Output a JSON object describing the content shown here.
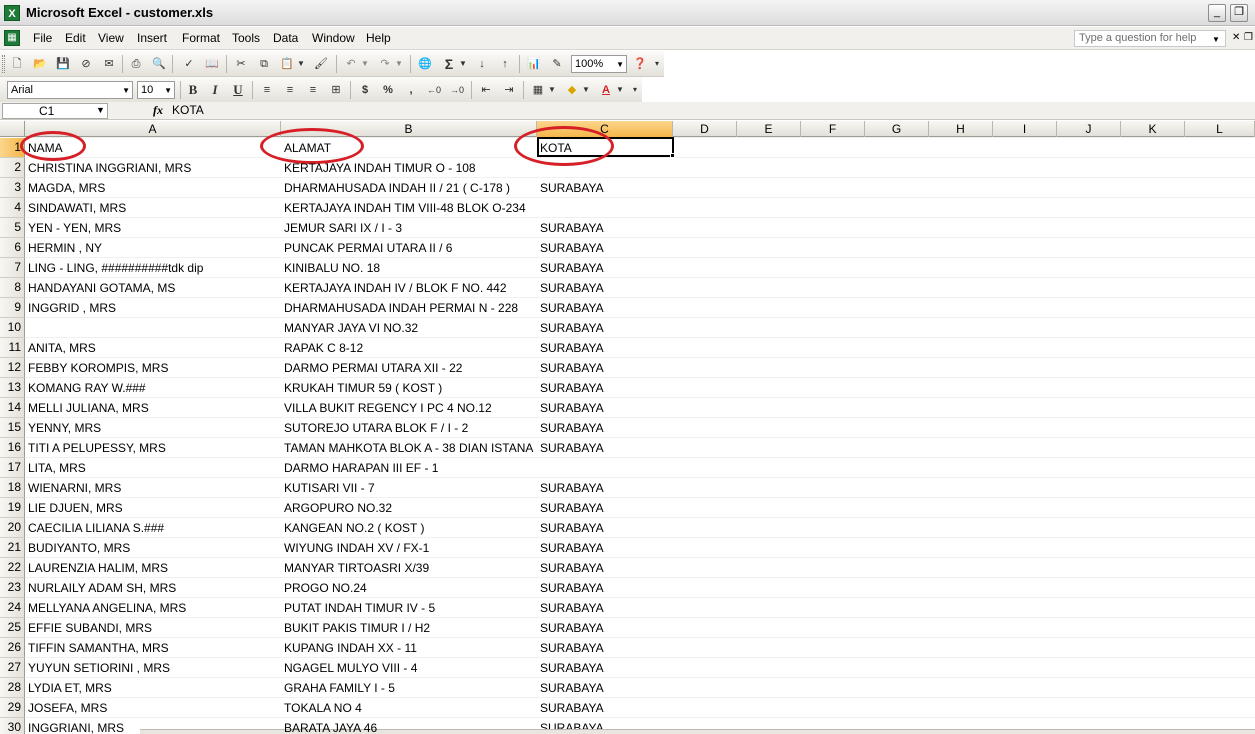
{
  "window": {
    "title": "Microsoft Excel - customer.xls"
  },
  "menu": [
    "File",
    "Edit",
    "View",
    "Insert",
    "Format",
    "Tools",
    "Data",
    "Window",
    "Help"
  ],
  "help_placeholder": "Type a question for help",
  "toolbar": {
    "zoom": "100%",
    "font": "Arial",
    "font_size": "10",
    "bold": "B",
    "italic": "I",
    "underline": "U",
    "currency": "$",
    "percent": "%",
    "comma": ",",
    "sum": "Σ"
  },
  "formula_bar": {
    "name_box": "C1",
    "formula": "KOTA",
    "fx": "fx"
  },
  "columns": [
    "A",
    "B",
    "C",
    "D",
    "E",
    "F",
    "G",
    "H",
    "I",
    "J",
    "K",
    "L"
  ],
  "rows": [
    {
      "n": "1",
      "a": "NAMA",
      "b": "ALAMAT",
      "c": "KOTA"
    },
    {
      "n": "2",
      "a": "CHRISTINA INGGRIANI, MRS",
      "b": "KERTAJAYA INDAH TIMUR O - 108",
      "c": ""
    },
    {
      "n": "3",
      "a": "MAGDA, MRS",
      "b": "DHARMAHUSADA INDAH II / 21  ( C-178 )",
      "c": "SURABAYA"
    },
    {
      "n": "4",
      "a": "SINDAWATI, MRS",
      "b": "KERTAJAYA INDAH TIM VIII-48 BLOK O-234",
      "c": ""
    },
    {
      "n": "5",
      "a": "YEN - YEN, MRS",
      "b": "JEMUR SARI IX / I - 3",
      "c": "SURABAYA"
    },
    {
      "n": "6",
      "a": "HERMIN , NY",
      "b": "PUNCAK PERMAI UTARA II / 6",
      "c": "SURABAYA"
    },
    {
      "n": "7",
      "a": "LING - LING, ##########tdk dip",
      "b": "KINIBALU NO. 18",
      "c": "SURABAYA"
    },
    {
      "n": "8",
      "a": "HANDAYANI GOTAMA, MS",
      "b": "KERTAJAYA INDAH IV / BLOK F NO. 442",
      "c": "SURABAYA"
    },
    {
      "n": "9",
      "a": "INGGRID , MRS",
      "b": "DHARMAHUSADA INDAH PERMAI N - 228",
      "c": "SURABAYA"
    },
    {
      "n": "10",
      "a": "",
      "b": "MANYAR JAYA VI NO.32",
      "c": "SURABAYA"
    },
    {
      "n": "11",
      "a": "ANITA, MRS",
      "b": "RAPAK C 8-12",
      "c": "SURABAYA"
    },
    {
      "n": "12",
      "a": "FEBBY KOROMPIS, MRS",
      "b": "DARMO PERMAI UTARA XII - 22",
      "c": "SURABAYA"
    },
    {
      "n": "13",
      "a": "KOMANG RAY W.###",
      "b": "KRUKAH TIMUR 59 ( KOST )",
      "c": "SURABAYA"
    },
    {
      "n": "14",
      "a": "MELLI JULIANA, MRS",
      "b": "VILLA BUKIT REGENCY I PC 4 NO.12",
      "c": "SURABAYA"
    },
    {
      "n": "15",
      "a": "YENNY, MRS",
      "b": "SUTOREJO UTARA BLOK F / I - 2",
      "c": "SURABAYA"
    },
    {
      "n": "16",
      "a": "TITI A PELUPESSY, MRS",
      "b": "TAMAN MAHKOTA BLOK A - 38 DIAN ISTANA",
      "c": "SURABAYA"
    },
    {
      "n": "17",
      "a": "LITA, MRS",
      "b": "DARMO HARAPAN III EF - 1",
      "c": ""
    },
    {
      "n": "18",
      "a": "WIENARNI, MRS",
      "b": "KUTISARI VII - 7",
      "c": "SURABAYA"
    },
    {
      "n": "19",
      "a": "LIE DJUEN, MRS",
      "b": "ARGOPURO NO.32",
      "c": "SURABAYA"
    },
    {
      "n": "20",
      "a": "CAECILIA LILIANA S.###",
      "b": "KANGEAN NO.2 ( KOST )",
      "c": "SURABAYA"
    },
    {
      "n": "21",
      "a": "BUDIYANTO, MRS",
      "b": "WIYUNG INDAH XV / FX-1",
      "c": "SURABAYA"
    },
    {
      "n": "22",
      "a": "LAURENZIA HALIM, MRS",
      "b": "MANYAR TIRTOASRI X/39",
      "c": "SURABAYA"
    },
    {
      "n": "23",
      "a": "NURLAILY ADAM SH, MRS",
      "b": "PROGO NO.24",
      "c": "SURABAYA"
    },
    {
      "n": "24",
      "a": "MELLYANA ANGELINA, MRS",
      "b": "PUTAT INDAH TIMUR IV - 5",
      "c": "SURABAYA"
    },
    {
      "n": "25",
      "a": "EFFIE SUBANDI, MRS",
      "b": "BUKIT PAKIS TIMUR I / H2",
      "c": "SURABAYA"
    },
    {
      "n": "26",
      "a": "TIFFIN SAMANTHA, MRS",
      "b": "KUPANG INDAH XX - 11",
      "c": "SURABAYA"
    },
    {
      "n": "27",
      "a": "YUYUN SETIORINI , MRS",
      "b": "NGAGEL MULYO VIII - 4",
      "c": "SURABAYA"
    },
    {
      "n": "28",
      "a": "LYDIA ET, MRS",
      "b": "GRAHA FAMILY I - 5",
      "c": "SURABAYA"
    },
    {
      "n": "29",
      "a": "JOSEFA, MRS",
      "b": "TOKALA NO 4",
      "c": "SURABAYA"
    },
    {
      "n": "30",
      "a": "INGGRIANI, MRS",
      "b": "BARATA JAYA 46",
      "c": "SURABAYA"
    }
  ],
  "colors": {
    "highlight_circle": "#d61f26",
    "active_header": "#f5b649",
    "excel_green": "#1f7a3a"
  },
  "icons": [
    "excel-icon",
    "minimize-icon",
    "restore-icon",
    "new-icon",
    "open-icon",
    "save-icon",
    "print-icon",
    "spelling-icon",
    "cut-icon",
    "copy-icon",
    "paste-icon",
    "undo-icon",
    "redo-icon",
    "hyperlink-icon",
    "sort-icon",
    "chart-icon",
    "help-icon",
    "borders-icon",
    "fill-color-icon",
    "font-color-icon"
  ]
}
